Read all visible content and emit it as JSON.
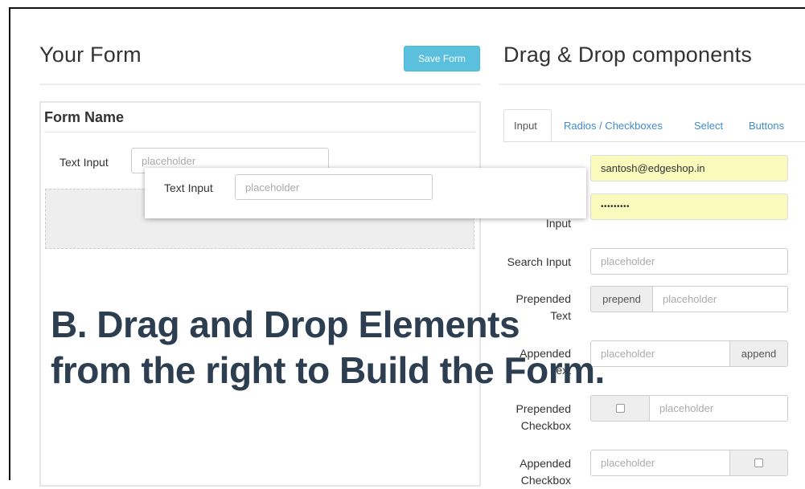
{
  "left_panel": {
    "title": "Your Form",
    "save_label": "Save Form",
    "form_name": "Form Name",
    "field_label": "Text Input",
    "field_placeholder": "placeholder"
  },
  "drag_card": {
    "label": "Text Input",
    "placeholder": "placeholder"
  },
  "right_panel": {
    "title": "Drag & Drop components",
    "tabs": [
      {
        "label": "Input",
        "active": true
      },
      {
        "label": "Radios / Checkboxes",
        "active": false
      },
      {
        "label": "Select",
        "active": false
      },
      {
        "label": "Buttons",
        "active": false
      }
    ],
    "components": {
      "text_input_value": "santosh@edgeshop.in",
      "password_value": "•••••••••",
      "password_label_tail": "Input",
      "search_label": "Search Input",
      "prepended_label_1": "Prepended",
      "prepended_label_2": "Text",
      "prepend_addon": "prepend",
      "appended_label_1": "Appended",
      "appended_label_2": "Text",
      "append_addon": "append",
      "prepended_checkbox_label_1": "Prepended",
      "prepended_checkbox_label_2": "Checkbox",
      "appended_checkbox_label_1": "Appended",
      "appended_checkbox_label_2": "Checkbox",
      "placeholder": "placeholder"
    }
  },
  "caption": {
    "line1": "B. Drag and Drop Elements",
    "line2": "from the right to Build the Form."
  },
  "colors": {
    "accent": "#5bc0de",
    "caption": "#2c3e50",
    "link": "#428bca",
    "autofill": "#fafabd"
  }
}
